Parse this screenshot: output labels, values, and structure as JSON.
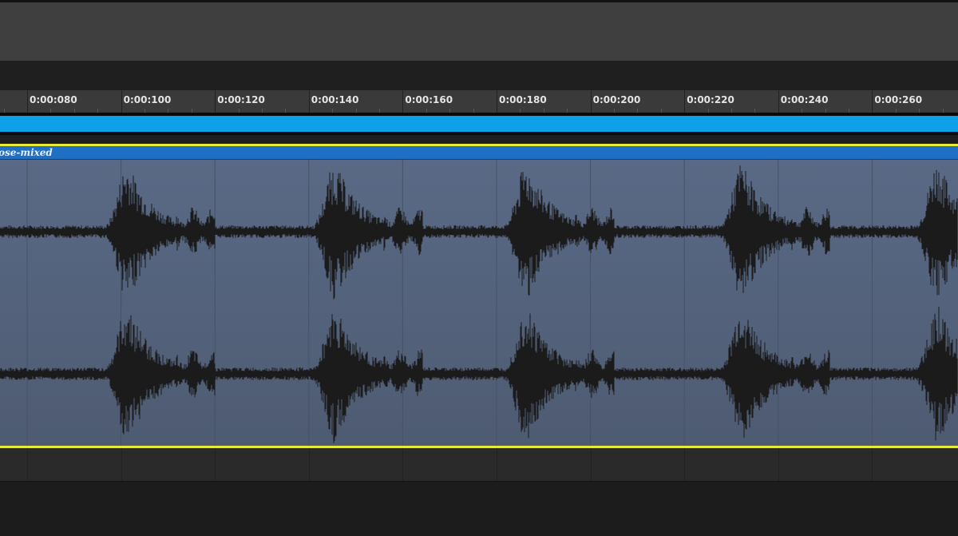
{
  "timeline": {
    "ruler_labels": [
      "0:00:080",
      "0:00:100",
      "0:00:120",
      "0:00:140",
      "0:00:160",
      "0:00:180",
      "0:00:200",
      "0:00:220",
      "0:00:240",
      "0:00:260"
    ]
  },
  "clip": {
    "name": "ose-mixed",
    "border_color": "#e7e93b",
    "header_color": "#1f6fc4",
    "body_color": "#56657e"
  },
  "loop_region": {
    "color": "#0ea1e8"
  },
  "colors": {
    "waveform": "#1b1b1b",
    "background": "#1e1e1e"
  }
}
